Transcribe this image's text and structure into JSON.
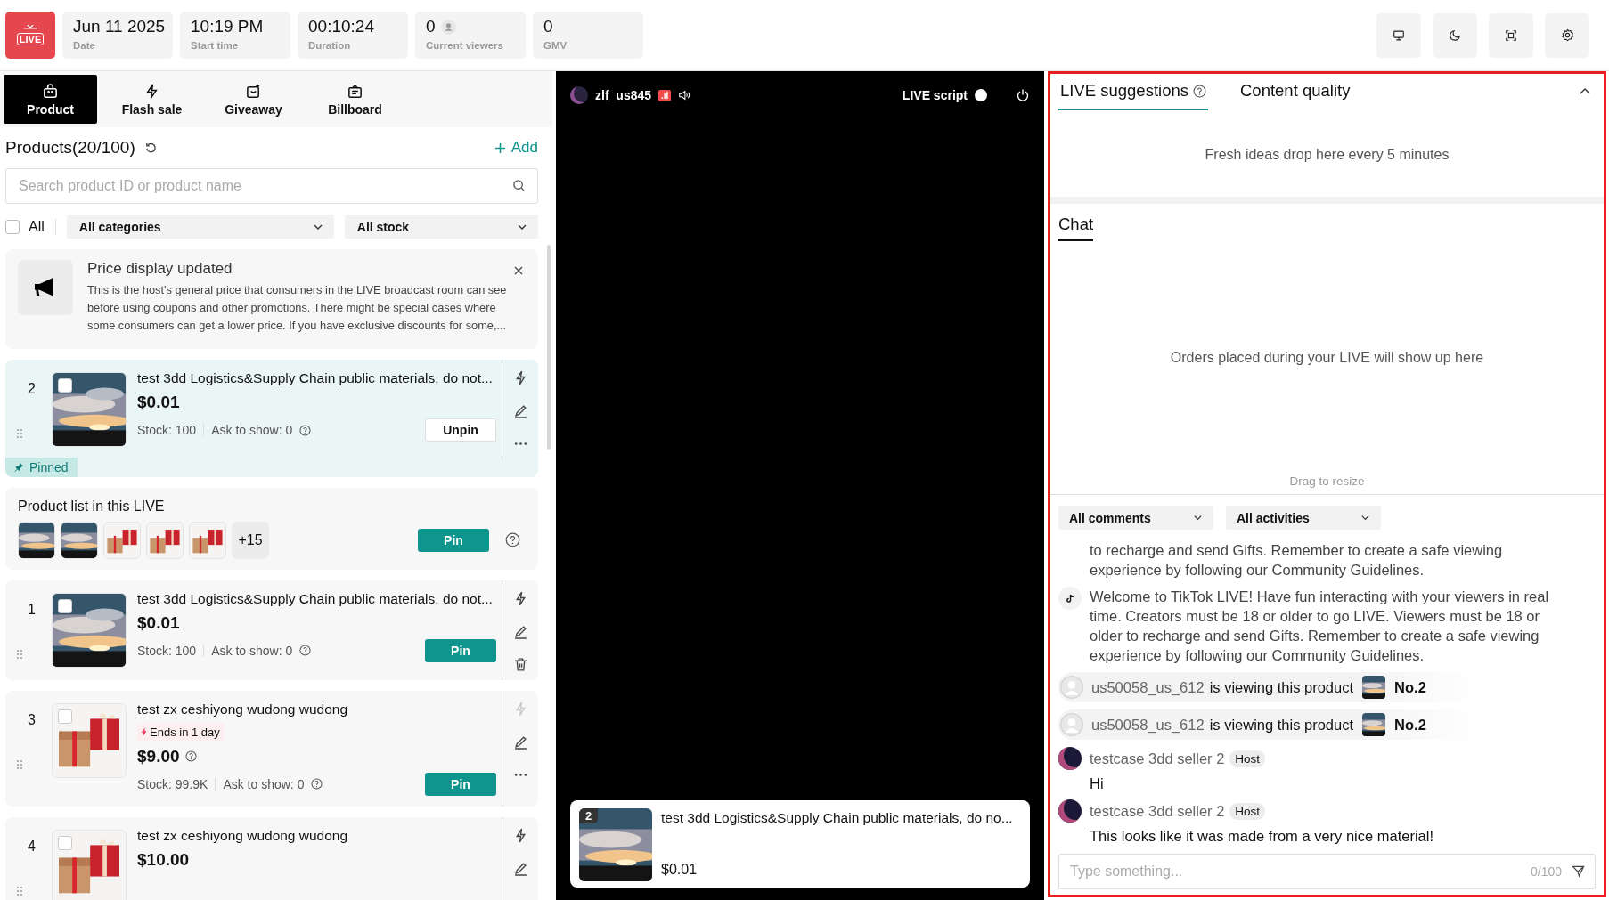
{
  "stats": [
    {
      "kind": "plain",
      "value": "Jun 11 2025",
      "label": "Date"
    },
    {
      "kind": "plain",
      "value": "10:19 PM",
      "label": "Start time"
    },
    {
      "kind": "plain",
      "value": "00:10:24",
      "label": "Duration"
    },
    {
      "kind": "viewers",
      "value": "0",
      "label": "Current viewers"
    },
    {
      "kind": "plain",
      "value": "0",
      "label": "GMV"
    }
  ],
  "logo": {
    "label": "LIVE"
  },
  "tabs": [
    {
      "kind": "bag",
      "label": "Product",
      "selected": true
    },
    {
      "kind": "bolt",
      "label": "Flash sale",
      "selected": false
    },
    {
      "kind": "gift",
      "label": "Giveaway",
      "selected": false
    },
    {
      "kind": "board",
      "label": "Billboard",
      "selected": false
    }
  ],
  "products_title": "Products(20/100)",
  "add_label": "Add",
  "search": {
    "placeholder": "Search product ID or product name"
  },
  "select_all": {
    "label": "All",
    "checked": false
  },
  "filters": [
    "All categories",
    "All stock"
  ],
  "notice": {
    "title": "Price display updated",
    "text": "This is the host's general price that consumers in the LIVE broadcast room can see before using coupons and other promotions. There might be special cases where some consumers can get a lower price. If you have exclusive discounts for some,..."
  },
  "pinned_product": {
    "number": "2",
    "thumb": {
      "kind": "sky"
    },
    "checked": false,
    "title": "test 3dd Logistics&Supply Chain public materials, do not...",
    "price": "$0.01",
    "stock": "Stock: 100",
    "ask": "Ask to show: 0",
    "button": {
      "kind": "outline",
      "label": "Unpin"
    },
    "badge": "Pinned",
    "actions": [
      {
        "kind": "bolt",
        "disabled": false
      },
      {
        "kind": "edit",
        "disabled": false
      },
      {
        "kind": "more",
        "disabled": false
      }
    ]
  },
  "live_list": {
    "title": "Product list in this LIVE",
    "thumbs": [
      {
        "kind": "sky"
      },
      {
        "kind": "sky"
      },
      {
        "kind": "gift"
      },
      {
        "kind": "gift"
      },
      {
        "kind": "gift"
      }
    ],
    "more": "+15",
    "button": "Pin"
  },
  "products": [
    {
      "number": "1",
      "thumb": {
        "kind": "sky"
      },
      "checked": false,
      "title": "test 3dd Logistics&Supply Chain public materials, do not...",
      "price": "$0.01",
      "price_help": false,
      "stock": "Stock: 100",
      "ask": "Ask to show: 0",
      "button": {
        "kind": "solid",
        "label": "Pin"
      },
      "actions": [
        {
          "kind": "bolt",
          "disabled": false
        },
        {
          "kind": "edit",
          "disabled": false
        },
        {
          "kind": "delete",
          "disabled": false
        }
      ]
    },
    {
      "number": "3",
      "thumb": {
        "kind": "gift"
      },
      "checked": false,
      "title": "test zx ceshiyong wudong wudong",
      "flash": "Ends in 1 day",
      "price": "$9.00",
      "price_help": true,
      "stock": "Stock: 99.9K",
      "ask": "Ask to show: 0",
      "button": {
        "kind": "solid",
        "label": "Pin"
      },
      "actions": [
        {
          "kind": "bolt",
          "disabled": true
        },
        {
          "kind": "edit",
          "disabled": false
        },
        {
          "kind": "more",
          "disabled": false
        }
      ]
    },
    {
      "number": "4",
      "thumb": {
        "kind": "gift"
      },
      "checked": false,
      "title": "test zx ceshiyong wudong wudong",
      "price": "$10.00",
      "price_help": false,
      "actions": [
        {
          "kind": "bolt",
          "disabled": false
        },
        {
          "kind": "edit",
          "disabled": false
        }
      ]
    }
  ],
  "video": {
    "username": "zlf_us845",
    "signal": ".ıl",
    "live_script": {
      "label": "LIVE script",
      "on": false
    },
    "featured": {
      "number": "2",
      "title": "test 3dd Logistics&Supply Chain public materials, do no...",
      "price": "$0.01"
    }
  },
  "side_tabs": [
    {
      "label": "LIVE suggestions",
      "help": true,
      "selected": true
    },
    {
      "label": "Content quality",
      "help": false,
      "selected": false
    }
  ],
  "suggestions_empty": "Fresh ideas drop here every 5 minutes",
  "chat_tabs": [
    {
      "label": "Chat",
      "selected": true
    }
  ],
  "orders_empty": "Orders placed during your LIVE will show up here",
  "resize_hint": "Drag to resize",
  "chat_filters": [
    "All comments",
    "All activities"
  ],
  "messages": [
    {
      "kind": "system",
      "icon": false,
      "text": "to recharge and send Gifts. Remember to create a safe viewing experience by following our Community Guidelines."
    },
    {
      "kind": "system",
      "icon": true,
      "text": "Welcome to TikTok LIVE! Have fun interacting with your viewers in real time. Creators must be 18 or older to go LIVE. Viewers must be 18 or older to recharge and send Gifts. Remember to create a safe viewing experience by following our Community Guidelines."
    },
    {
      "kind": "viewing",
      "user": "us50058_us_612",
      "text": "is viewing this product",
      "product": "No.2"
    },
    {
      "kind": "viewing",
      "user": "us50058_us_612",
      "text": "is viewing this product",
      "product": "No.2"
    },
    {
      "kind": "comment",
      "user": "testcase 3dd seller 2",
      "badge": "Host",
      "text": "Hi"
    },
    {
      "kind": "comment",
      "user": "testcase 3dd seller 2",
      "badge": "Host",
      "text": "This looks like it was made from a very nice material!"
    }
  ],
  "chat_input": {
    "placeholder": "Type something...",
    "counter": "0/100"
  }
}
